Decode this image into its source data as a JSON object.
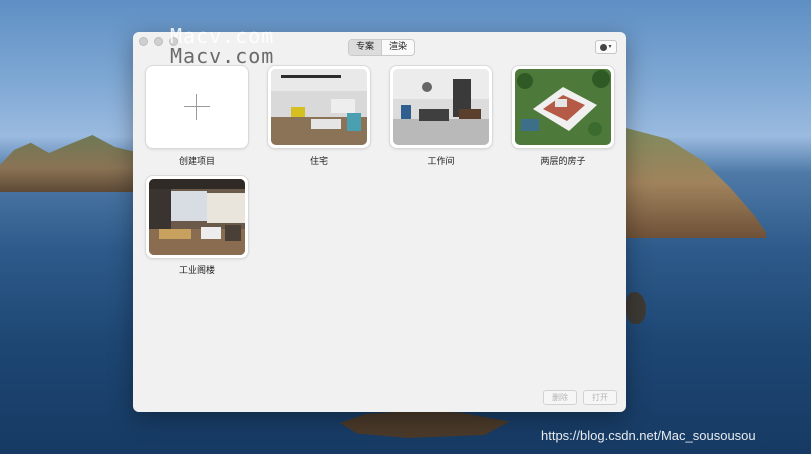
{
  "window": {
    "mode_tabs": [
      {
        "label": "专案",
        "active": true
      },
      {
        "label": "渲染",
        "active": false
      }
    ]
  },
  "projects": [
    {
      "label": "创建项目",
      "icon": "plus-icon"
    },
    {
      "label": "住宅"
    },
    {
      "label": "工作间"
    },
    {
      "label": "两层的房子"
    },
    {
      "label": "工业阁楼"
    }
  ],
  "footer": {
    "delete_label": "删除",
    "open_label": "打开"
  },
  "watermarks": {
    "top": "Macv.com",
    "bottom": "https://blog.csdn.net/Mac_sousousou"
  },
  "colors": {
    "window_bg": "#f1f1f1",
    "disabled_text": "#b5b5b5"
  }
}
